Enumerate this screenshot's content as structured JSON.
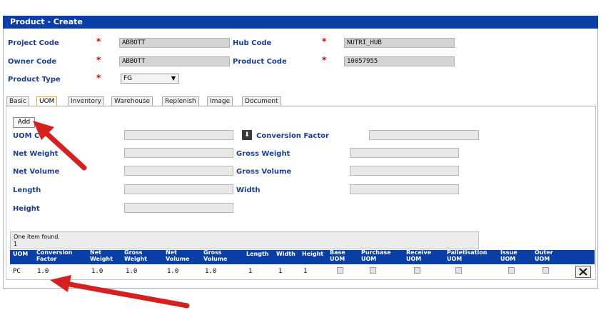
{
  "form": {
    "title": "Product - Create"
  },
  "fields": {
    "project_code": {
      "label": "Project Code",
      "value": "ABBOTT"
    },
    "hub_code": {
      "label": "Hub Code",
      "value": "NUTRI_HUB"
    },
    "owner_code": {
      "label": "Owner Code",
      "value": "ABBOTT"
    },
    "product_code": {
      "label": "Product Code",
      "value": "10057955"
    },
    "product_type": {
      "label": "Product Type",
      "value": "FG"
    },
    "required_mark": "*"
  },
  "tabs": [
    "Basic",
    "UOM",
    "Inventory",
    "Warehouse",
    "Replenish",
    "Image",
    "Document"
  ],
  "active_tab": "UOM",
  "uom_form": {
    "add_label": "Add",
    "uom_code_label": "UOM C",
    "conversion_factor_label": "Conversion Factor",
    "net_weight_label": "Net Weight",
    "gross_weight_label": "Gross Weight",
    "net_volume_label": "Net Volume",
    "gross_volume_label": "Gross Volume",
    "length_label": "Length",
    "width_label": "Width",
    "height_label": "Height"
  },
  "table": {
    "status": "One item found.",
    "status_line2": "1",
    "headers": [
      "UOM",
      "Conversion Factor",
      "Net Weight",
      "Gross Weight",
      "Net Volume",
      "Gross Volume",
      "Length",
      "Width",
      "Height",
      "Base UOM",
      "Purchase UOM",
      "Receive UOM",
      "Palletisation UOM",
      "Issue UOM",
      "Outer UOM"
    ],
    "row": {
      "uom": "PC",
      "conversion_factor": "1.0",
      "net_weight": "1.0",
      "gross_weight": "1.0",
      "net_volume": "1.0",
      "gross_volume": "1.0",
      "length": "1",
      "width": "1",
      "height": "1"
    }
  },
  "colors": {
    "header_blue": "#0a3fa8",
    "label_blue": "#1c3f8f",
    "required_red": "#cc0000",
    "annotation_arrow": "#d61f1f"
  }
}
